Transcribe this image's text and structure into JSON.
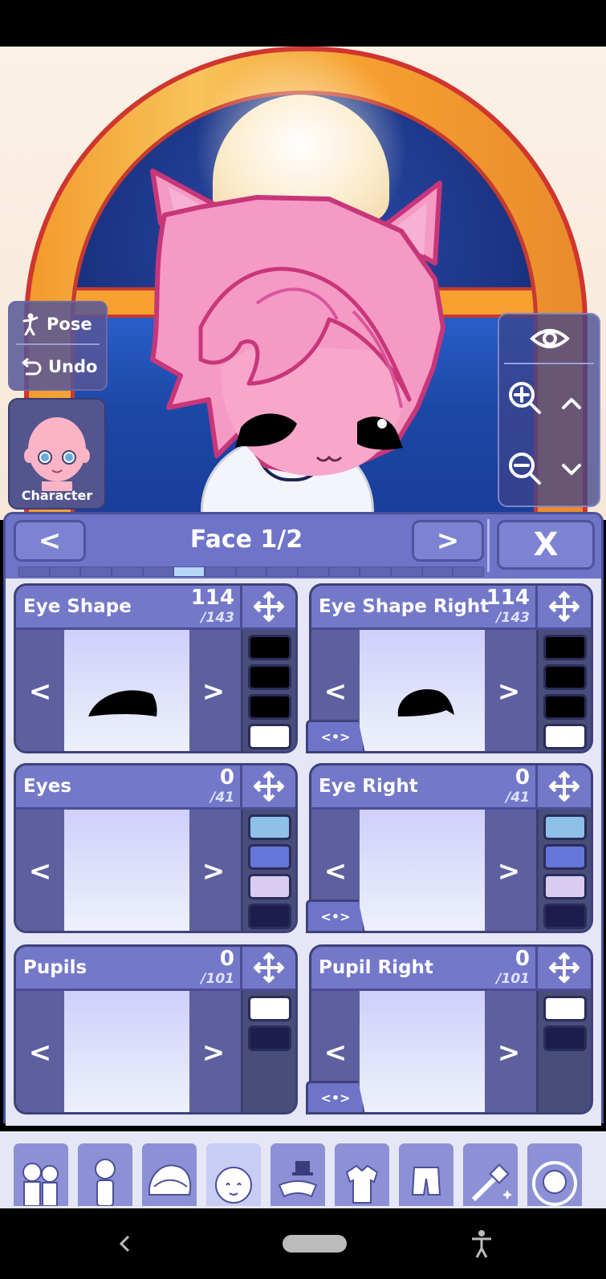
{
  "scene": {
    "left_tools": {
      "pose_label": "Pose",
      "undo_label": "Undo"
    },
    "character_button_label": "Character"
  },
  "panel": {
    "prev_label": "<",
    "next_label": ">",
    "close_label": "X",
    "title": "Face 1/2",
    "page_count": 15,
    "active_page_index": 5
  },
  "cards": [
    {
      "title": "Eye Shape",
      "count": "114",
      "total": "/143",
      "prev": "<",
      "next": ">",
      "swatches": [
        "#000000",
        "#000000",
        "#000000",
        "#ffffff"
      ]
    },
    {
      "title": "Eye Shape Right",
      "count": "114",
      "total": "/143",
      "prev": "<",
      "next": ">",
      "swatches": [
        "#000000",
        "#000000",
        "#000000",
        "#ffffff"
      ]
    },
    {
      "title": "Eyes",
      "count": "0",
      "total": "/41",
      "prev": "<",
      "next": ">",
      "swatches": [
        "#8fc0e8",
        "#6675d9",
        "#d8cdf0",
        "#1c1d4e"
      ]
    },
    {
      "title": "Eye Right",
      "count": "0",
      "total": "/41",
      "prev": "<",
      "next": ">",
      "swatches": [
        "#8fc0e8",
        "#6675d9",
        "#d8cdf0",
        "#1c1d4e"
      ]
    },
    {
      "title": "Pupils",
      "count": "0",
      "total": "/101",
      "prev": "<",
      "next": ">",
      "swatches": [
        "#ffffff",
        "#1c1d4e"
      ]
    },
    {
      "title": "Pupil Right",
      "count": "0",
      "total": "/101",
      "prev": "<",
      "next": ">",
      "swatches": [
        "#ffffff",
        "#1c1d4e"
      ]
    }
  ],
  "mirror_label": "<•>",
  "bottom_tabs": [
    "group-icon",
    "body-icon",
    "hair-icon",
    "face-icon",
    "accessories-icon",
    "tops-icon",
    "bottoms-icon",
    "props-icon",
    "profile-icon"
  ],
  "colors": {
    "panel": "#6e74c8",
    "accent": "#b8d6f5",
    "hair": "#f59ac5"
  }
}
